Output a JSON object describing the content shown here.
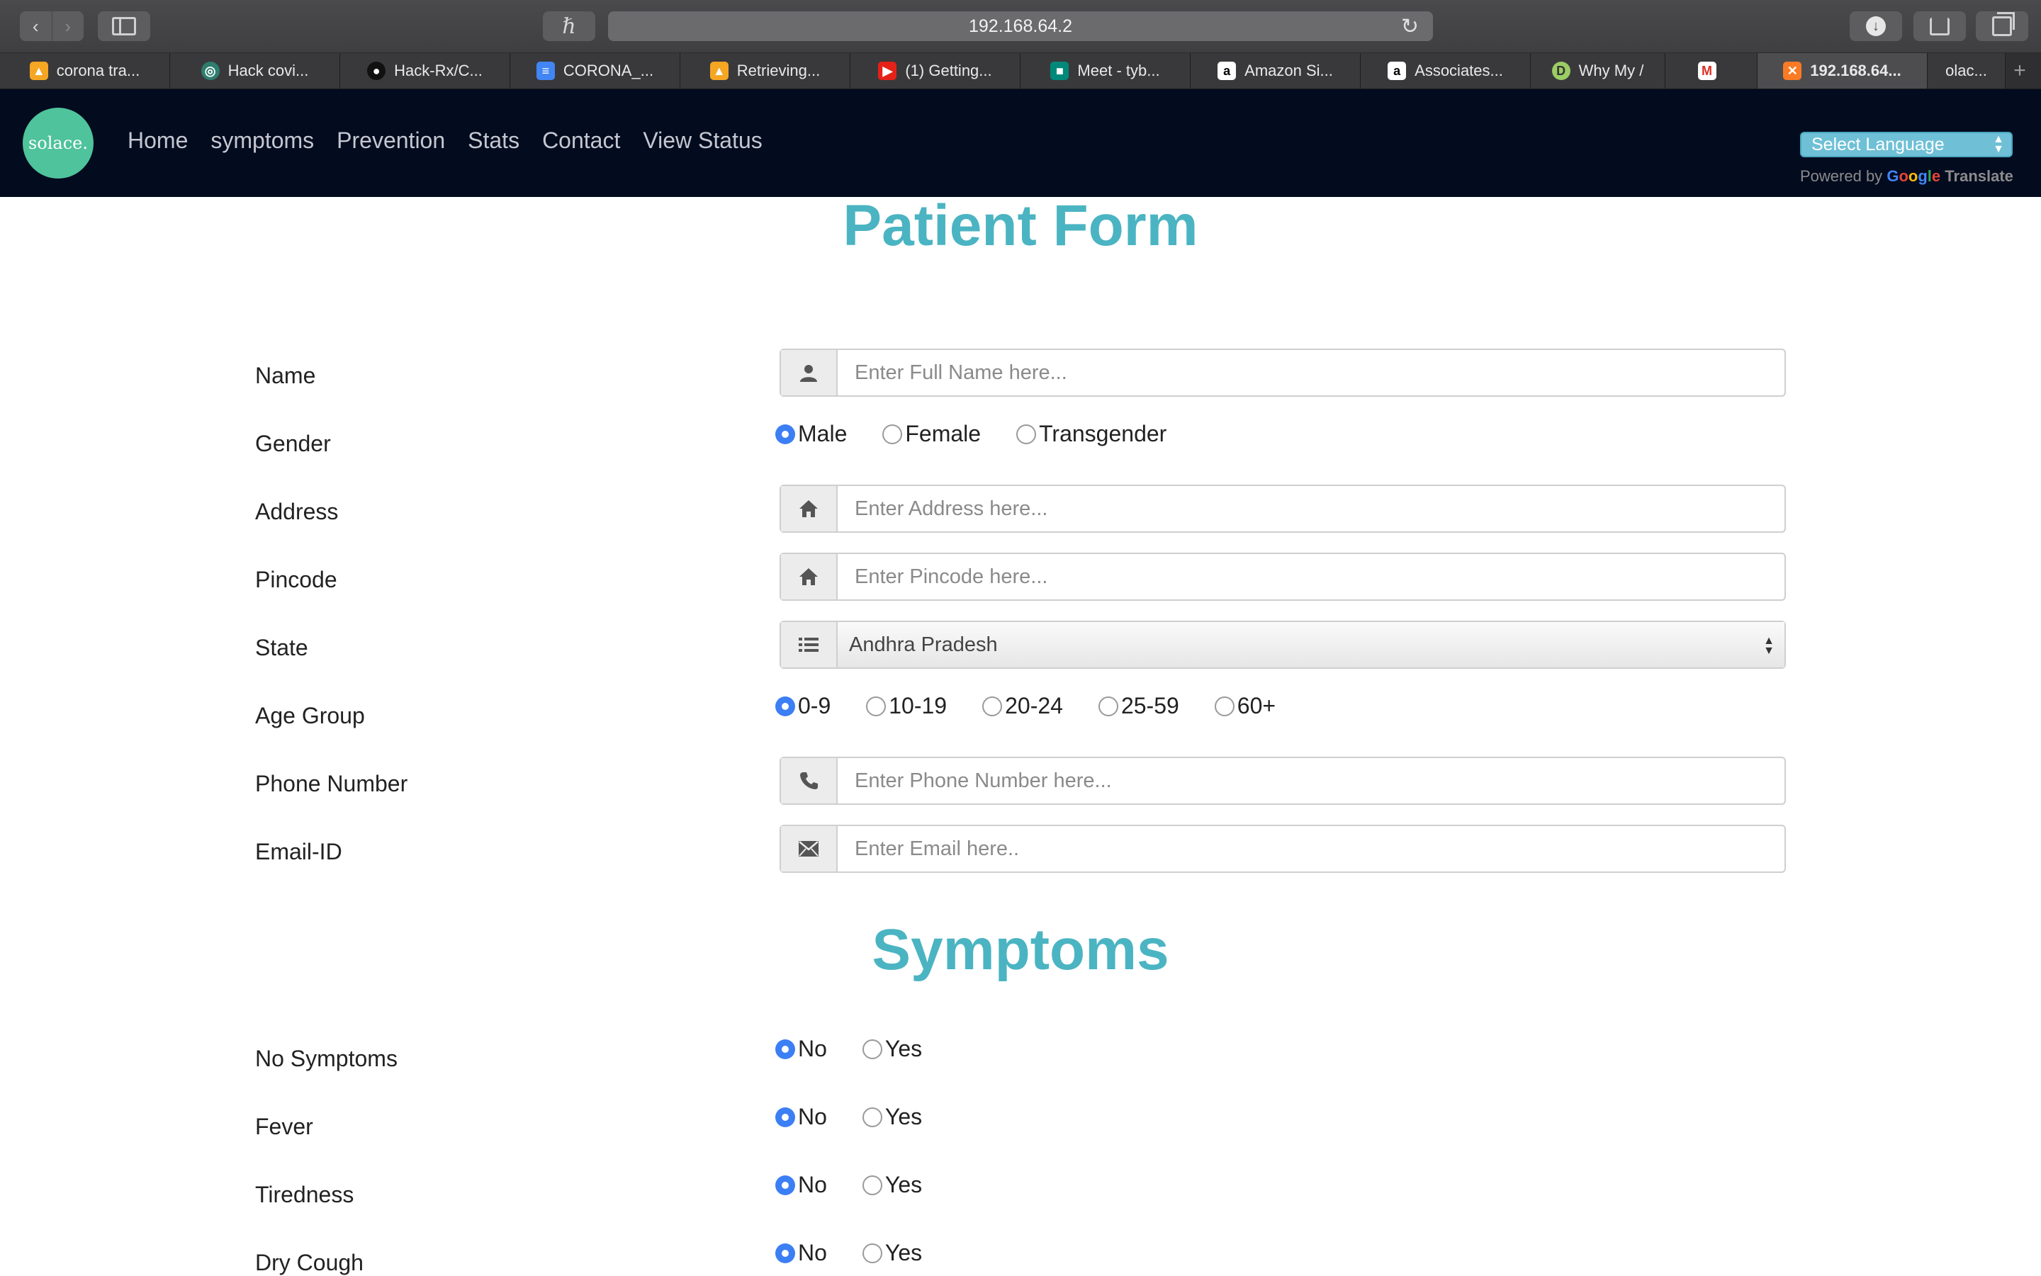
{
  "browser": {
    "url": "192.168.64.2",
    "tabs": [
      {
        "label": "corona tra...",
        "icon": "firebase-icon"
      },
      {
        "label": "Hack covi...",
        "icon": "hackathon-icon"
      },
      {
        "label": "Hack-Rx/C...",
        "icon": "github-icon"
      },
      {
        "label": "CORONA_...",
        "icon": "docs-icon"
      },
      {
        "label": "Retrieving...",
        "icon": "firebase-icon"
      },
      {
        "label": "(1) Getting...",
        "icon": "youtube-icon"
      },
      {
        "label": "Meet - tyb...",
        "icon": "meet-icon"
      },
      {
        "label": "Amazon Si...",
        "icon": "amazon-icon"
      },
      {
        "label": "Associates...",
        "icon": "amazon-icon"
      },
      {
        "label": "Why My /",
        "icon": "d-icon"
      },
      {
        "label": "",
        "icon": "gmail-icon"
      },
      {
        "label": "192.168.64...",
        "icon": "xampp-icon"
      },
      {
        "label": "olac...",
        "icon": ""
      }
    ]
  },
  "site": {
    "logo_text": "solace.",
    "nav": [
      "Home",
      "symptoms",
      "Prevention",
      "Stats",
      "Contact",
      "View Status"
    ],
    "language_select": "Select Language",
    "powered_by": "Powered by",
    "google": "Google",
    "translate": "Translate"
  },
  "form": {
    "title": "Patient Form",
    "name": {
      "label": "Name",
      "placeholder": "Enter Full Name here..."
    },
    "gender": {
      "label": "Gender",
      "options": [
        "Male",
        "Female",
        "Transgender"
      ],
      "selected": "Male"
    },
    "address": {
      "label": "Address",
      "placeholder": "Enter Address here..."
    },
    "pincode": {
      "label": "Pincode",
      "placeholder": "Enter Pincode here..."
    },
    "state": {
      "label": "State",
      "value": "Andhra Pradesh"
    },
    "age_group": {
      "label": "Age Group",
      "options": [
        "0-9",
        "10-19",
        "20-24",
        "25-59",
        "60+"
      ],
      "selected": "0-9"
    },
    "phone": {
      "label": "Phone Number",
      "placeholder": "Enter Phone Number here..."
    },
    "email": {
      "label": "Email-ID",
      "placeholder": "Enter Email here.."
    }
  },
  "symptoms": {
    "title": "Symptoms",
    "no_label": "No",
    "yes_label": "Yes",
    "items": [
      {
        "label": "No Symptoms",
        "selected": "No"
      },
      {
        "label": "Fever",
        "selected": "No"
      },
      {
        "label": "Tiredness",
        "selected": "No"
      },
      {
        "label": "Dry Cough",
        "selected": "No"
      }
    ]
  },
  "colors": {
    "heading": "#4bb4c2",
    "nav_bg": "#030b1f",
    "logo": "#4fc39b",
    "radio_selected": "#3c7ff5"
  }
}
